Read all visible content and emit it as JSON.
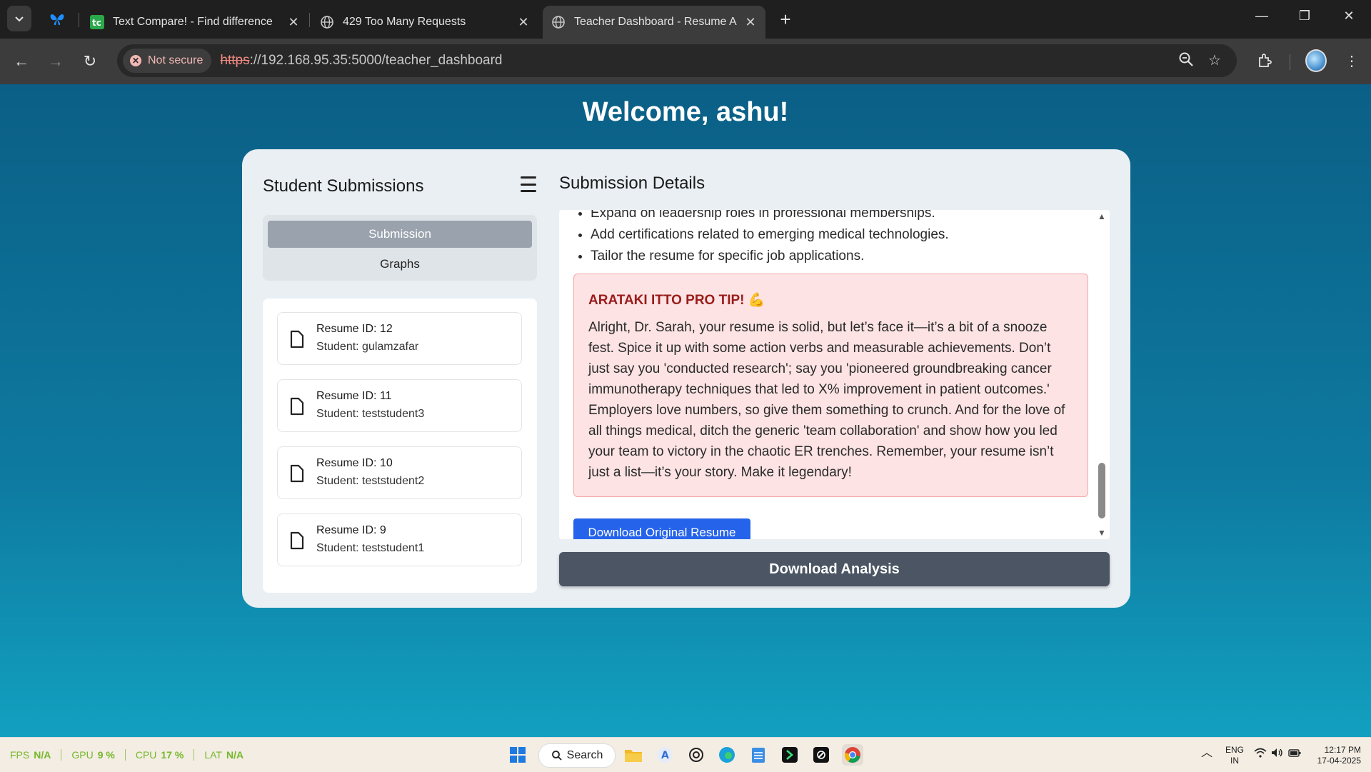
{
  "browser": {
    "tabs": [
      {
        "title": "Text Compare! - Find difference",
        "active": false
      },
      {
        "title": "429 Too Many Requests",
        "active": false
      },
      {
        "title": "Teacher Dashboard - Resume A",
        "active": true
      }
    ],
    "security_label": "Not secure",
    "url_scheme": "https",
    "url_rest": "://192.168.95.35:5000/teacher_dashboard"
  },
  "page": {
    "welcome": "Welcome, ashu!",
    "left": {
      "title": "Student Submissions",
      "menu": {
        "submission": "Submission",
        "graphs": "Graphs"
      },
      "submissions": [
        {
          "id_label": "Resume ID: 12",
          "student_label": "Student: gulamzafar"
        },
        {
          "id_label": "Resume ID: 11",
          "student_label": "Student: teststudent3"
        },
        {
          "id_label": "Resume ID: 10",
          "student_label": "Student: teststudent2"
        },
        {
          "id_label": "Resume ID: 9",
          "student_label": "Student: teststudent1"
        }
      ]
    },
    "right": {
      "title": "Submission Details",
      "bullets": [
        "Expand on leadership roles in professional memberships.",
        "Add certifications related to emerging medical technologies.",
        "Tailor the resume for specific job applications."
      ],
      "tip_title": "ARATAKI ITTO PRO TIP! 💪",
      "tip_body": "Alright, Dr. Sarah, your resume is solid, but let’s face it—it’s a bit of a snooze fest. Spice it up with some action verbs and measurable achievements. Don’t just say you 'conducted research'; say you 'pioneered groundbreaking cancer immunotherapy techniques that led to X% improvement in patient outcomes.' Employers love numbers, so give them something to crunch. And for the love of all things medical, ditch the generic 'team collaboration' and show how you led your team to victory in the chaotic ER trenches. Remember, your resume isn’t just a list—it’s your story. Make it legendary!",
      "download_original": "Download Original Resume",
      "download_analysis": "Download Analysis"
    }
  },
  "taskbar": {
    "perf": [
      {
        "label": "FPS",
        "value": "N/A"
      },
      {
        "label": "GPU",
        "value": "9 %"
      },
      {
        "label": "CPU",
        "value": "17 %"
      },
      {
        "label": "LAT",
        "value": "N/A"
      }
    ],
    "search_label": "Search",
    "lang_top": "ENG",
    "lang_bottom": "IN",
    "time": "12:17 PM",
    "date": "17-04-2025"
  },
  "colors": {
    "accent_blue": "#2563eb",
    "tip_title": "#9b1c1c",
    "tip_bg": "#fde3e3",
    "dark_button": "#4b5563"
  }
}
